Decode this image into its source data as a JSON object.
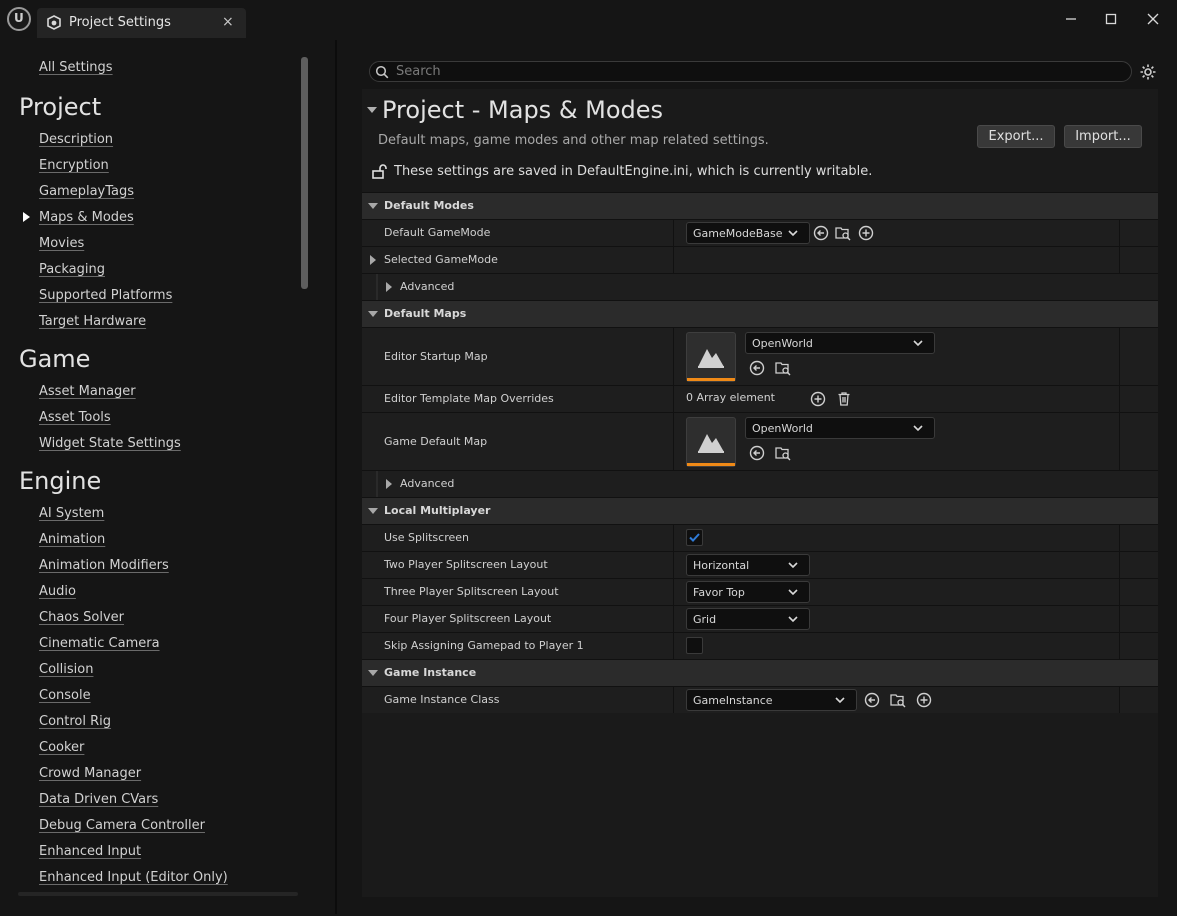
{
  "window": {
    "tab_title": "Project Settings",
    "tab_close": "×",
    "minimize": "—",
    "maximize": "☐",
    "close": "✕"
  },
  "sidebar": {
    "all_settings": "All Settings",
    "sections": [
      {
        "heading": "Project",
        "items": [
          "Description",
          "Encryption",
          "GameplayTags",
          "Maps & Modes",
          "Movies",
          "Packaging",
          "Supported Platforms",
          "Target Hardware"
        ]
      },
      {
        "heading": "Game",
        "items": [
          "Asset Manager",
          "Asset Tools",
          "Widget State Settings"
        ]
      },
      {
        "heading": "Engine",
        "items": [
          "AI System",
          "Animation",
          "Animation Modifiers",
          "Audio",
          "Chaos Solver",
          "Cinematic Camera",
          "Collision",
          "Console",
          "Control Rig",
          "Cooker",
          "Crowd Manager",
          "Data Driven CVars",
          "Debug Camera Controller",
          "Enhanced Input",
          "Enhanced Input (Editor Only)"
        ]
      }
    ],
    "selected": "Maps & Modes"
  },
  "search": {
    "placeholder": "Search",
    "value": ""
  },
  "header": {
    "title": "Project - Maps & Modes",
    "description": "Default maps, game modes and other map related settings.",
    "export_label": "Export...",
    "import_label": "Import...",
    "save_note": "These settings are saved in DefaultEngine.ini, which is currently writable."
  },
  "categories": {
    "default_modes": {
      "label": "Default Modes",
      "default_gamemode_label": "Default GameMode",
      "default_gamemode_value": "GameModeBase",
      "selected_gamemode_label": "Selected GameMode",
      "advanced_label": "Advanced"
    },
    "default_maps": {
      "label": "Default Maps",
      "editor_startup_map_label": "Editor Startup Map",
      "editor_startup_map_value": "OpenWorld",
      "template_overrides_label": "Editor Template Map Overrides",
      "template_overrides_value": "0 Array element",
      "game_default_map_label": "Game Default Map",
      "game_default_map_value": "OpenWorld",
      "advanced_label": "Advanced"
    },
    "local_multiplayer": {
      "label": "Local Multiplayer",
      "use_splitscreen_label": "Use Splitscreen",
      "use_splitscreen_checked": true,
      "two_player_label": "Two Player Splitscreen Layout",
      "two_player_value": "Horizontal",
      "three_player_label": "Three Player Splitscreen Layout",
      "three_player_value": "Favor Top",
      "four_player_label": "Four Player Splitscreen Layout",
      "four_player_value": "Grid",
      "skip_gamepad_label": "Skip Assigning Gamepad to Player 1",
      "skip_gamepad_checked": false
    },
    "game_instance": {
      "label": "Game Instance",
      "class_label": "Game Instance Class",
      "class_value": "GameInstance"
    }
  },
  "colors": {
    "accent_orange": "#f08a17",
    "checkbox_blue": "#2f7bd8"
  }
}
